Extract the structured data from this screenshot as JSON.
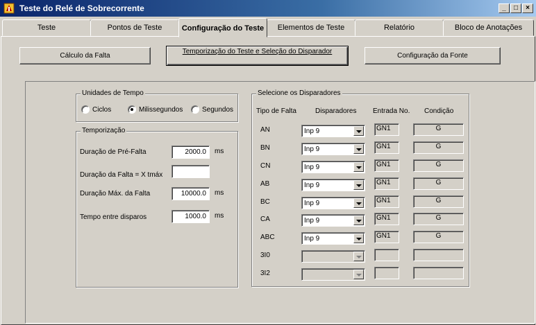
{
  "window": {
    "title": "Teste do Relé de Sobrecorrente",
    "controls": {
      "minimize": "_",
      "maximize": "□",
      "close": "×"
    }
  },
  "tabs": [
    {
      "label": "Teste"
    },
    {
      "label": "Pontos de Teste"
    },
    {
      "label": "Configuração do Teste",
      "active": true
    },
    {
      "label": "Elementos de Teste"
    },
    {
      "label": "Relatório"
    },
    {
      "label": "Bloco de Anotações"
    }
  ],
  "toolbar": {
    "calc_fault": "Cálculo da Falta",
    "timing_trigger": "Temporização do Teste e Seleção do Disparador",
    "source_config": "Configuração da Fonte"
  },
  "time_units": {
    "legend": "Unidades de Tempo",
    "options": [
      "Ciclos",
      "Milissegundos",
      "Segundos"
    ],
    "selected": "Milissegundos"
  },
  "timing": {
    "legend": "Temporização",
    "prefault": {
      "label": "Duração de Pré-Falta",
      "value": "2000.0",
      "unit": "ms"
    },
    "fault_x_tmax": {
      "label": "Duração da Falta = X tmáx",
      "value": ""
    },
    "max_fault": {
      "label": "Duração Máx. da Falta",
      "value": "10000.0",
      "unit": "ms"
    },
    "between_triggers": {
      "label": "Tempo entre disparos",
      "value": "1000.0",
      "unit": "ms"
    }
  },
  "triggers": {
    "legend": "Selecione os Disparadores",
    "headers": {
      "fault_type": "Tipo de Falta",
      "triggers": "Disparadores",
      "input_no": "Entrada No.",
      "condition": "Condição"
    },
    "rows": [
      {
        "fault": "AN",
        "trigger": "Inp 9",
        "input": "GN1",
        "condition": "G"
      },
      {
        "fault": "BN",
        "trigger": "Inp 9",
        "input": "GN1",
        "condition": "G"
      },
      {
        "fault": "CN",
        "trigger": "Inp 9",
        "input": "GN1",
        "condition": "G"
      },
      {
        "fault": "AB",
        "trigger": "Inp 9",
        "input": "GN1",
        "condition": "G"
      },
      {
        "fault": "BC",
        "trigger": "Inp 9",
        "input": "GN1",
        "condition": "G"
      },
      {
        "fault": "CA",
        "trigger": "Inp 9",
        "input": "GN1",
        "condition": "G"
      },
      {
        "fault": "ABC",
        "trigger": "Inp 9",
        "input": "GN1",
        "condition": "G"
      },
      {
        "fault": "3I0",
        "trigger": "",
        "input": "",
        "condition": ""
      },
      {
        "fault": "3I2",
        "trigger": "",
        "input": "",
        "condition": ""
      }
    ]
  }
}
